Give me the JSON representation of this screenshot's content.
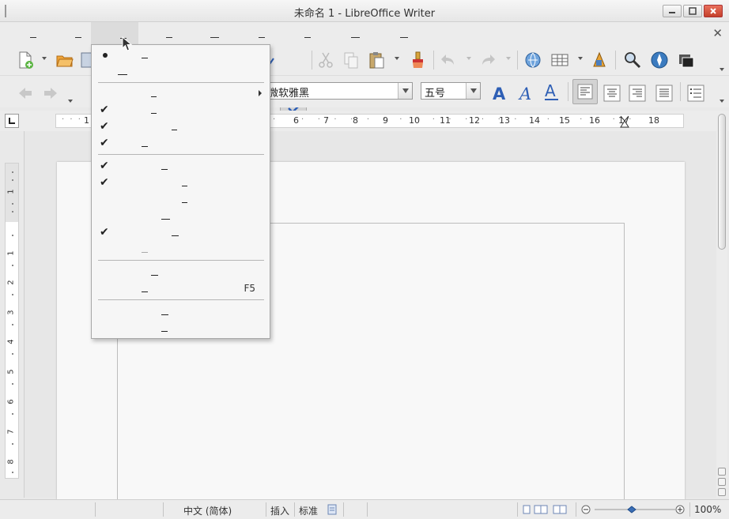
{
  "window": {
    "title": "未命名 1 - LibreOffice Writer"
  },
  "menubar": {
    "item_count": 9,
    "active_index": 2
  },
  "toolbar": {
    "font_name": "微软雅黑",
    "font_size": "五号"
  },
  "ruler": {
    "numbers": [
      "1",
      "6",
      "7",
      "8",
      "9",
      "10",
      "11",
      "12",
      "13",
      "14",
      "15",
      "16",
      "17",
      "18"
    ],
    "vertical_numbers": [
      "1",
      "1",
      "2",
      "3",
      "4",
      "5",
      "6",
      "7",
      "8"
    ]
  },
  "view_menu": {
    "items": [
      {
        "mark": "bullet"
      },
      {
        "mark": "none"
      },
      {
        "mark": "none",
        "submenu": true
      },
      {
        "mark": "check"
      },
      {
        "mark": "check"
      },
      {
        "mark": "check"
      },
      {
        "mark": "check"
      },
      {
        "mark": "check"
      },
      {
        "mark": "none"
      },
      {
        "mark": "none"
      },
      {
        "mark": "check"
      },
      {
        "mark": "none"
      },
      {
        "mark": "none"
      },
      {
        "mark": "none",
        "accel": "F5"
      },
      {
        "mark": "none"
      },
      {
        "mark": "none"
      }
    ]
  },
  "statusbar": {
    "language": "中文 (简体)",
    "insert_mode": "插入",
    "selection_mode": "标准",
    "zoom": "100%"
  },
  "colors": {
    "accent_blue": "#2e5fb5",
    "menu_bg": "#f6f6f6",
    "page_bg": "#f8f8f8"
  },
  "icons": [
    "new-document-icon",
    "open-icon",
    "spellcheck-icon",
    "cut-icon",
    "copy-icon",
    "paste-icon",
    "clone-formatting-icon",
    "undo-icon",
    "redo-icon",
    "hyperlink-icon",
    "table-icon",
    "show-draw-icon",
    "find-icon",
    "navigator-icon",
    "gallery-icon"
  ]
}
